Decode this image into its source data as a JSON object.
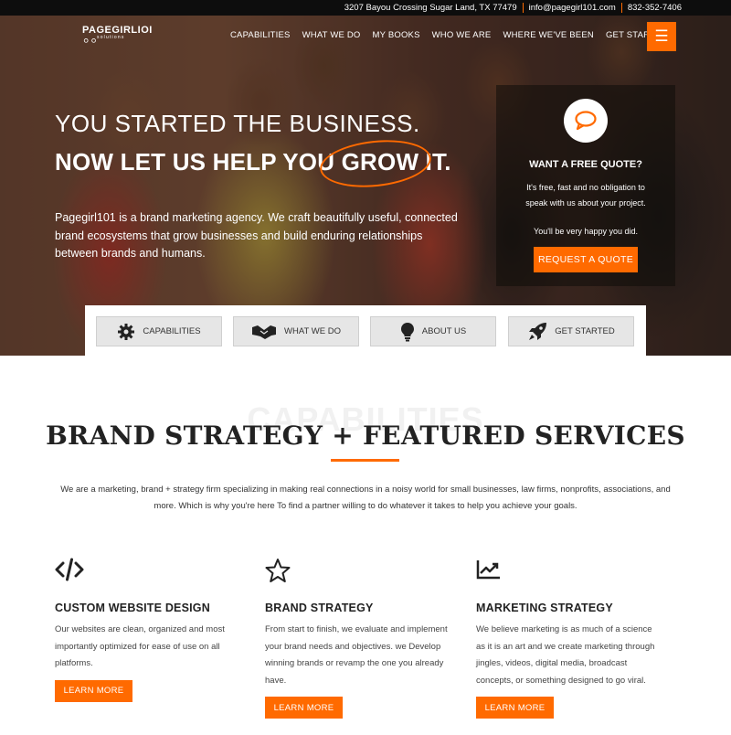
{
  "topbar": {
    "address": "3207 Bayou Crossing Sugar Land, TX 77479",
    "email": "info@pagegirl101.com",
    "phone": "832-352-7406"
  },
  "brand": {
    "name": "PAGEGIRLIOI",
    "tagline": "solutions"
  },
  "nav": {
    "items": [
      "CAPABILITIES",
      "WHAT WE DO",
      "MY BOOKS",
      "WHO WE ARE",
      "WHERE WE'VE BEEN",
      "GET STARTED"
    ],
    "menu_icon": "hamburger-icon"
  },
  "hero": {
    "headline_line1": "YOU STARTED THE BUSINESS.",
    "headline_line2": "NOW LET US HELP YOU GROW IT.",
    "intro": "Pagegirl101 is a brand marketing agency. We craft beautifully useful, connected brand ecosystems that grow businesses and build enduring relationships between brands and humans."
  },
  "quote": {
    "title": "WANT A FREE QUOTE?",
    "text": "It's free, fast and no obligation to speak with us about your project.",
    "text2": "You'll be very happy you did.",
    "button": "REQUEST A QUOTE"
  },
  "quick_nav": [
    {
      "label": "CAPABILITIES",
      "icon": "gear-icon"
    },
    {
      "label": "WHAT WE DO",
      "icon": "handshake-icon"
    },
    {
      "label": "ABOUT US",
      "icon": "lightbulb-icon"
    },
    {
      "label": "GET STARTED",
      "icon": "rocket-icon"
    }
  ],
  "services": {
    "watermark": "CAPABILITIES",
    "title": "BRAND STRATEGY + FEATURED SERVICES",
    "intro": "We are a marketing, brand + strategy firm specializing in making real connections in a noisy world for small businesses, law firms, nonprofits, associations, and more. Which is why you're here To find a partner willing to do whatever it takes to help you achieve your goals.",
    "cards": [
      {
        "icon": "code-icon",
        "title": "CUSTOM WEBSITE DESIGN",
        "text": "Our websites are clean, organized and most importantly optimized for ease of use on all platforms.",
        "button": "LEARN MORE"
      },
      {
        "icon": "star-icon",
        "title": "BRAND STRATEGY",
        "text": "From start to finish, we evaluate and implement your brand needs and objectives. we Develop winning brands or revamp the one you already have.",
        "button": "LEARN MORE"
      },
      {
        "icon": "chart-icon",
        "title": "MARKETING STRATEGY",
        "text": "We believe marketing is as much of a science as it is an art and we create marketing through jingles, videos, digital media, broadcast concepts, or something designed to go viral.",
        "button": "LEARN MORE"
      }
    ]
  },
  "colors": {
    "accent": "#ff6a00",
    "topbar": "#0d0d0d"
  }
}
